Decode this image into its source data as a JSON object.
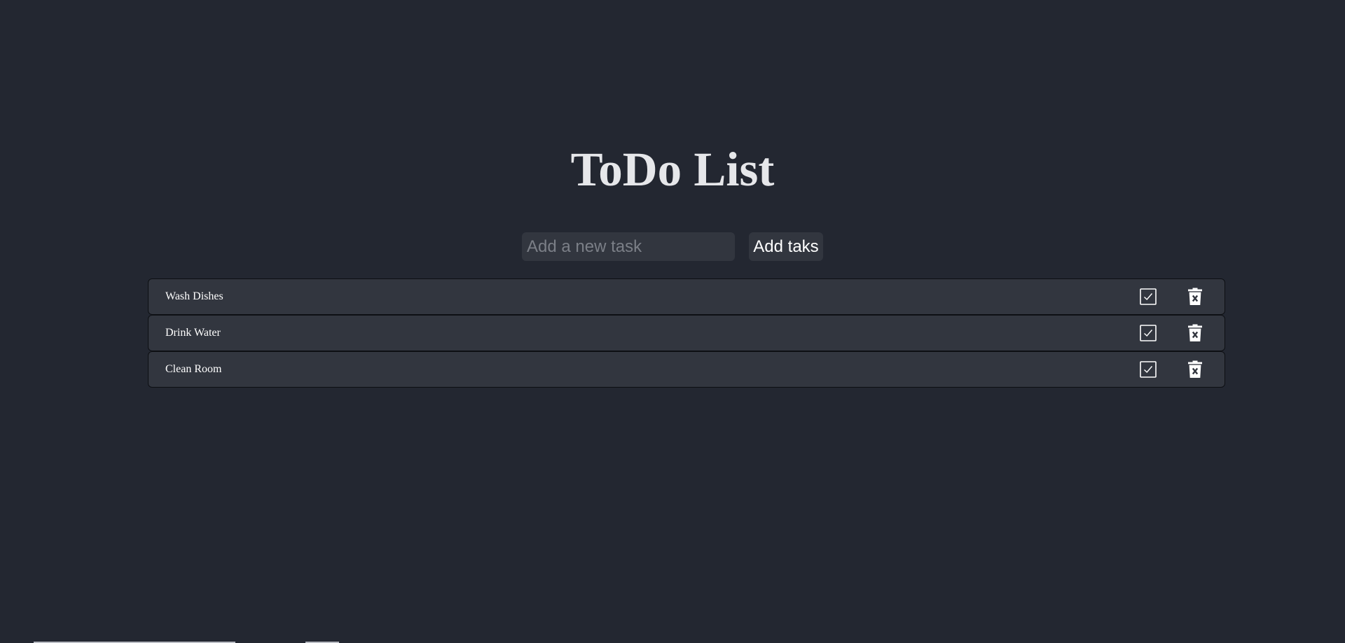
{
  "page": {
    "title": "ToDo List"
  },
  "add_form": {
    "placeholder": "Add a new task",
    "value": "",
    "button_label": "Add taks"
  },
  "tasks": [
    {
      "text": "Wash Dishes",
      "complete_icon": "checkbox-check-icon",
      "delete_icon": "trash-icon"
    },
    {
      "text": "Drink Water",
      "complete_icon": "checkbox-check-icon",
      "delete_icon": "trash-icon"
    },
    {
      "text": "Clean Room",
      "complete_icon": "checkbox-check-icon",
      "delete_icon": "trash-icon"
    }
  ],
  "colors": {
    "background": "#232731",
    "surface": "#32363f",
    "border": "#0d0f13",
    "title": "#e6e7ea",
    "text": "#ffffff",
    "placeholder": "#7b7f87"
  }
}
